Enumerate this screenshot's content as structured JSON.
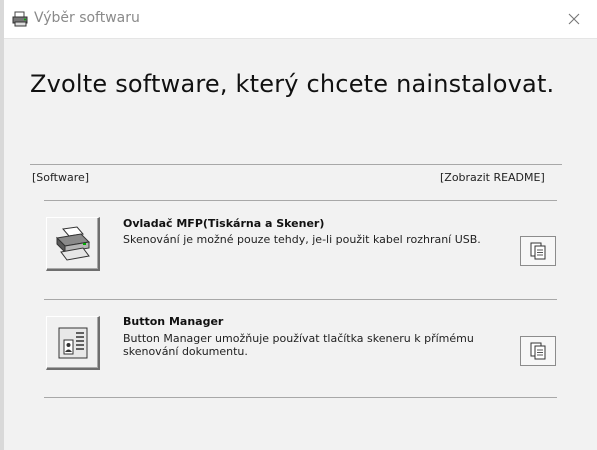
{
  "window": {
    "title": "Výběr softwaru"
  },
  "heading": "Zvolte software, který chcete nainstalovat.",
  "columns": {
    "software": "[Software]",
    "readme": "[Zobrazit README]"
  },
  "items": [
    {
      "title": "Ovladač MFP(Tiskárna a Skener)",
      "description": "Skenování je možné pouze tehdy, je-li použit kabel rozhraní USB.",
      "icon": "scanner-printer-icon",
      "readme_icon": "document-icon"
    },
    {
      "title": "Button Manager",
      "description": "Button Manager umožňuje používat tlačítka skeneru k přímému skenování dokumentu.",
      "icon": "button-manager-icon",
      "readme_icon": "document-icon"
    }
  ],
  "colors": {
    "background": "#f2f2f2",
    "titlebar": "#ffffff",
    "divider": "#a8a8a8"
  }
}
